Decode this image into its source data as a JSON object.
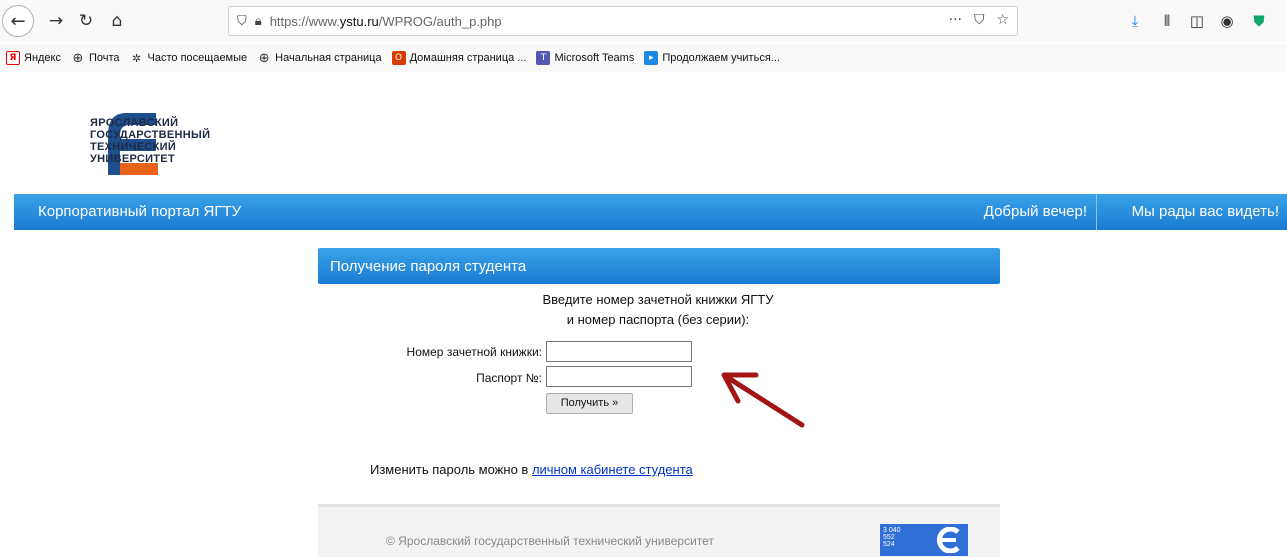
{
  "browser": {
    "url_prefix": "https://www.",
    "url_host": "ystu.ru",
    "url_path": "/WPROG/auth_p.php",
    "icons": {
      "back": "back-arrow-icon",
      "forward": "forward-arrow-icon",
      "reload": "reload-icon",
      "home": "home-icon",
      "shield": "tracking-shield-icon",
      "lock": "lock-icon",
      "more": "ellipsis-icon",
      "pocket": "pocket-icon",
      "bookmark_star": "star-icon",
      "download": "download-icon",
      "library": "library-icon",
      "sidebar": "sidebar-icon",
      "account": "account-icon",
      "extension": "extension-shield-icon"
    },
    "bookmarks": [
      {
        "label": "Яндекс",
        "icon": "yandex-icon"
      },
      {
        "label": "Почта",
        "icon": "globe-icon"
      },
      {
        "label": "Часто посещаемые",
        "icon": "gear-icon"
      },
      {
        "label": "Начальная страница",
        "icon": "globe-icon"
      },
      {
        "label": "Домашняя страница ...",
        "icon": "office-icon"
      },
      {
        "label": "Microsoft Teams",
        "icon": "teams-icon"
      },
      {
        "label": "Продолжаем учиться...",
        "icon": "learning-icon"
      }
    ]
  },
  "site": {
    "logo_lines": [
      "ЯРОСЛАВСКИЙ",
      "ГОСУДАРСТВЕННЫЙ",
      "ТЕХНИЧЕСКИЙ",
      "УНИВЕРСИТЕТ"
    ],
    "banner_title": "Корпоративный портал ЯГТУ",
    "greeting": "Добрый вечер!",
    "welcome": "Мы рады вас видеть!",
    "colors": {
      "brand_blue": "#1a7bd0",
      "logo_orange": "#e8631a",
      "logo_navy": "#1f4e8c"
    }
  },
  "form": {
    "panel_title": "Получение пароля студента",
    "intro_line1": "Введите номер зачетной книжки ЯГТУ",
    "intro_line2": "и номер паспорта (без серии):",
    "record_book_label": "Номер зачетной книжки:",
    "record_book_value": "",
    "passport_label": "Паспорт №:",
    "passport_value": "",
    "submit_label": "Получить »"
  },
  "change_password": {
    "text": "Изменить пароль можно в ",
    "link_text": "личном кабинете студента"
  },
  "footer": {
    "copyright": "© Ярославский государственный технический университет",
    "counter_lines": [
      "3 040",
      "552",
      "524"
    ]
  }
}
